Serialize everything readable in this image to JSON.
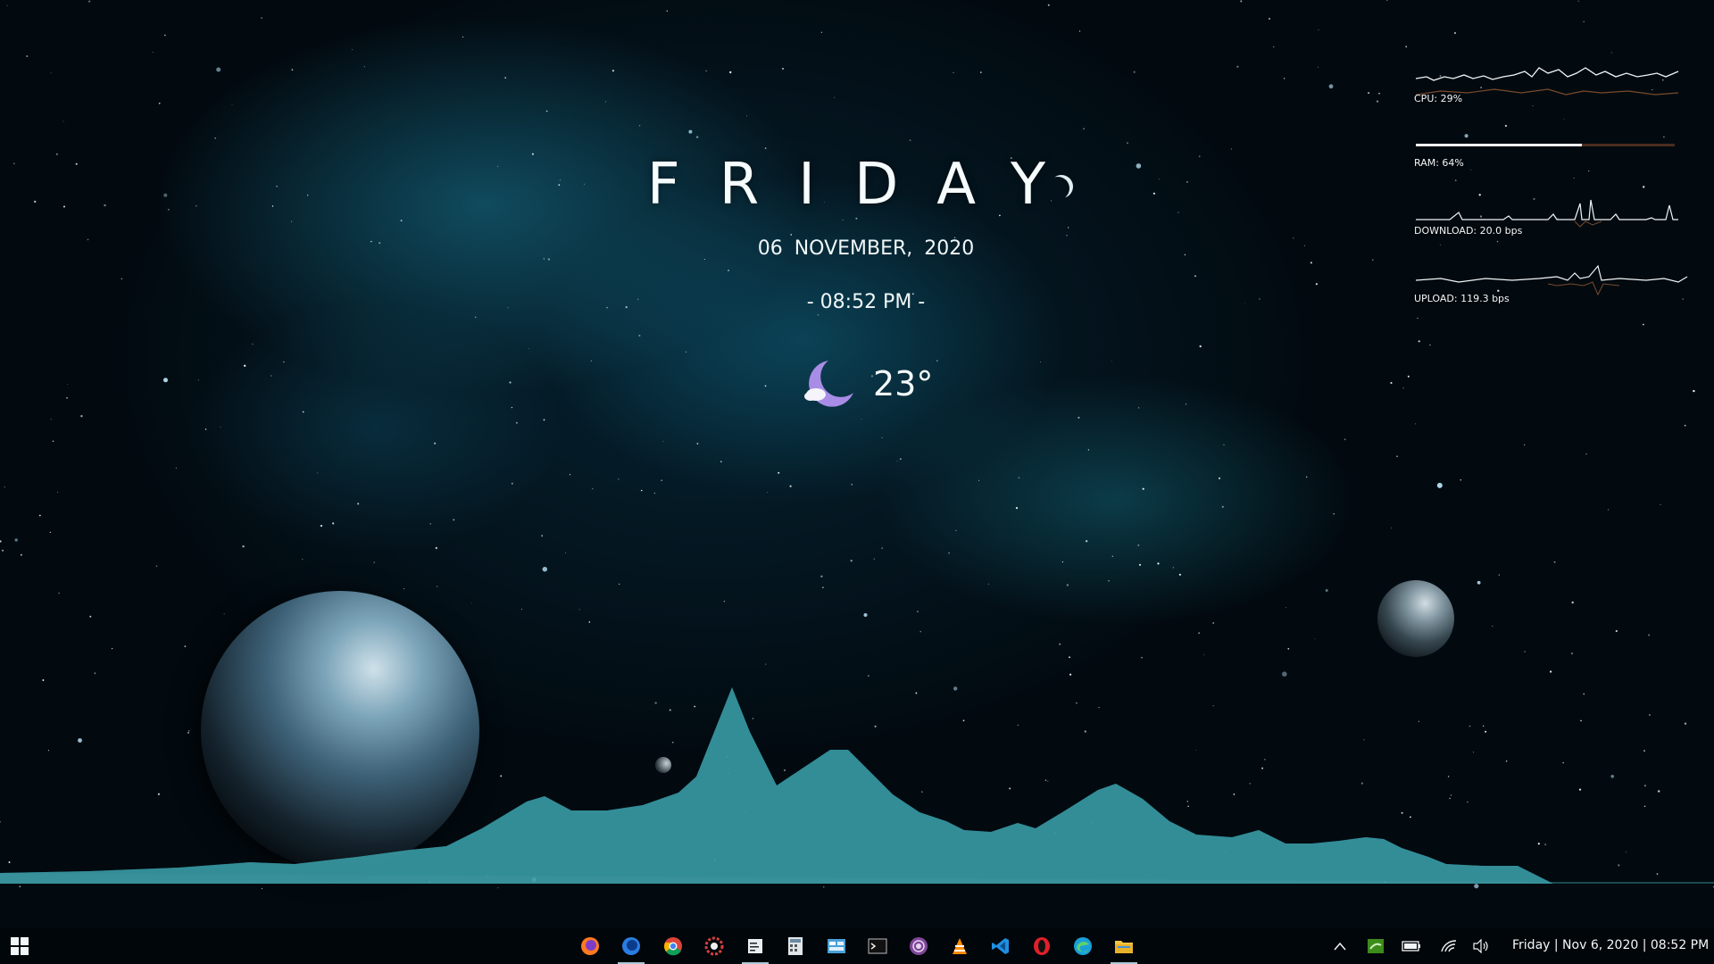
{
  "widget": {
    "day": "FRIDAY",
    "date": "06 NOVEMBER, 2020",
    "time": "- 08:52 PM -",
    "temperature": "23°",
    "weather_icon": "moon-cloud-icon"
  },
  "system_monitor": {
    "cpu_label": "CPU: 29%",
    "cpu_percent": 29,
    "ram_label": "RAM: 64%",
    "ram_fraction": 0.64,
    "download_label": "DOWNLOAD: 20.0 bps",
    "upload_label": "UPLOAD: 119.3 bps"
  },
  "taskbar": {
    "start_icon": "windows-logo-icon",
    "apps": [
      {
        "name": "firefox",
        "icon": "firefox-icon",
        "active": false
      },
      {
        "name": "firefox-developer",
        "icon": "firefox-dev-icon",
        "active": true
      },
      {
        "name": "chrome",
        "icon": "chrome-icon",
        "active": false
      },
      {
        "name": "settings-gear",
        "icon": "gear-icon",
        "active": false
      },
      {
        "name": "notepad",
        "icon": "notepad-icon",
        "active": true
      },
      {
        "name": "calculator",
        "icon": "calculator-icon",
        "active": false
      },
      {
        "name": "control-panel",
        "icon": "control-panel-icon",
        "active": false
      },
      {
        "name": "terminal",
        "icon": "terminal-icon",
        "active": false
      },
      {
        "name": "tor-browser",
        "icon": "tor-icon",
        "active": false
      },
      {
        "name": "vlc",
        "icon": "vlc-icon",
        "active": false
      },
      {
        "name": "vscode",
        "icon": "vscode-icon",
        "active": false
      },
      {
        "name": "opera",
        "icon": "opera-icon",
        "active": false
      },
      {
        "name": "edge",
        "icon": "edge-icon",
        "active": false
      },
      {
        "name": "file-explorer",
        "icon": "folder-icon",
        "active": true
      }
    ],
    "tray": [
      "chevron-up-icon",
      "nvidia-icon",
      "battery-icon",
      "wifi-icon",
      "volume-icon"
    ],
    "clock": "Friday | Nov 6, 2020 | 08:52 PM"
  },
  "colors": {
    "visualizer": "#3c9ca6",
    "weather_moon": "#a98ce6",
    "accent_line": "#a8c8d8"
  }
}
